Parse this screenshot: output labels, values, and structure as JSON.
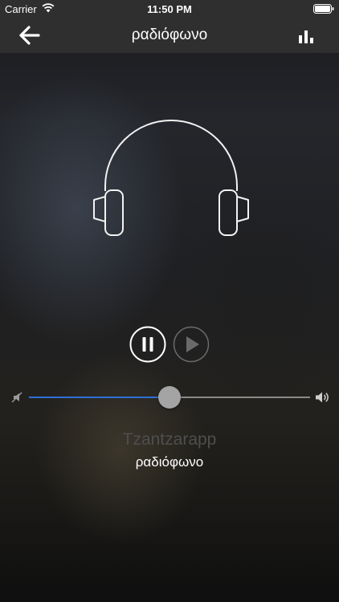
{
  "status_bar": {
    "carrier": "Carrier",
    "time": "11:50 PM",
    "icons": [
      "wifi-icon",
      "battery-icon"
    ]
  },
  "nav": {
    "title": "ραδιόφωνο",
    "back_icon": "arrow-left-icon",
    "right_icon": "bar-chart-icon"
  },
  "player": {
    "artwork_icon": "headphones-icon",
    "pause_icon": "pause-icon",
    "play_icon": "play-icon",
    "volume": {
      "level": 0.5,
      "min_icon": "volume-mute-icon",
      "max_icon": "volume-high-icon",
      "fill_color": "#2f6fd8"
    },
    "station_name": "Tzantzarapp",
    "subtitle": "ραδιόφωνο"
  },
  "colors": {
    "bar_background": "#2f2f2f",
    "accent": "#2f6fd8"
  }
}
